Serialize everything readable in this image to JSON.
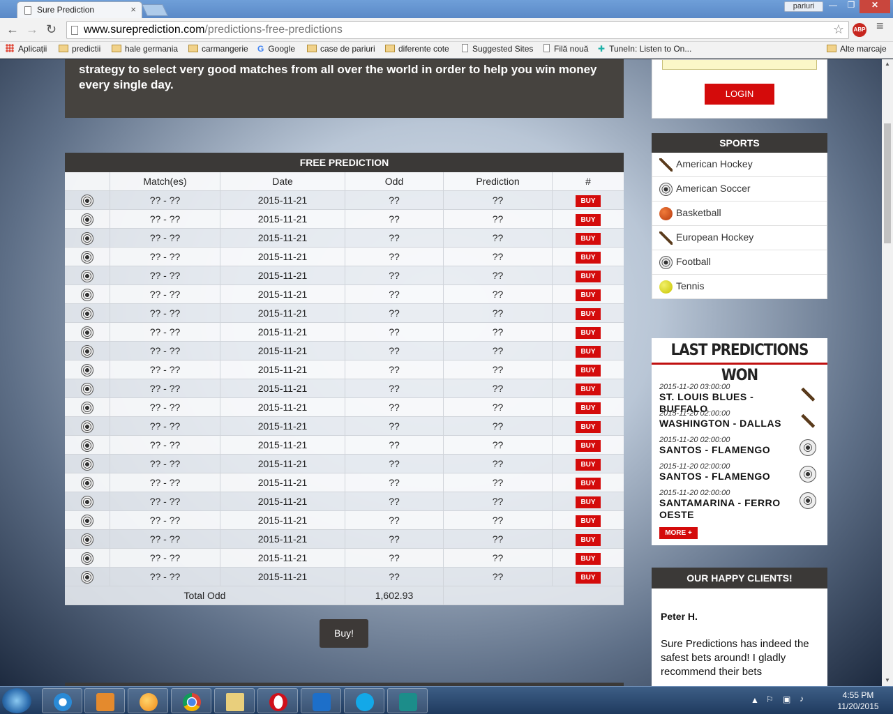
{
  "browser": {
    "tab_title": "Sure Prediction",
    "tab_close": "×",
    "profile": "pariuri",
    "url_host": "www.sureprediction.com",
    "url_path": "/predictions-free-predictions",
    "abp_label": "ABP",
    "controls": {
      "back": "←",
      "forward": "→",
      "reload": "↻",
      "minimize": "—",
      "maximize": "❐",
      "close": "✕",
      "star": "☆",
      "menu": "≡"
    }
  },
  "bookmarks": [
    {
      "label": "Aplicații",
      "icon": "apps-icon"
    },
    {
      "label": "predictii",
      "icon": "folder-icon"
    },
    {
      "label": "hale germania",
      "icon": "folder-icon"
    },
    {
      "label": "carmangerie",
      "icon": "folder-icon"
    },
    {
      "label": "Google",
      "icon": "google-icon"
    },
    {
      "label": "case de pariuri",
      "icon": "folder-icon"
    },
    {
      "label": "diferente cote",
      "icon": "folder-icon"
    },
    {
      "label": "Suggested Sites",
      "icon": "page-icon"
    },
    {
      "label": "Filă nouă",
      "icon": "page-icon"
    },
    {
      "label": "TuneIn: Listen to On...",
      "icon": "tunein-icon"
    },
    {
      "label": "Alte marcaje",
      "icon": "folder-icon"
    }
  ],
  "intro_text": "strategy to select very good matches from all over the world in order to help you win money every single day.",
  "free_prediction": {
    "title": "FREE PREDICTION",
    "headers": [
      "",
      "Match(es)",
      "Date",
      "Odd",
      "Prediction",
      "#"
    ],
    "rows": [
      {
        "match": "?? - ??",
        "date": "2015-11-21",
        "odd": "??",
        "prediction": "??",
        "action": "BUY"
      },
      {
        "match": "?? - ??",
        "date": "2015-11-21",
        "odd": "??",
        "prediction": "??",
        "action": "BUY"
      },
      {
        "match": "?? - ??",
        "date": "2015-11-21",
        "odd": "??",
        "prediction": "??",
        "action": "BUY"
      },
      {
        "match": "?? - ??",
        "date": "2015-11-21",
        "odd": "??",
        "prediction": "??",
        "action": "BUY"
      },
      {
        "match": "?? - ??",
        "date": "2015-11-21",
        "odd": "??",
        "prediction": "??",
        "action": "BUY"
      },
      {
        "match": "?? - ??",
        "date": "2015-11-21",
        "odd": "??",
        "prediction": "??",
        "action": "BUY"
      },
      {
        "match": "?? - ??",
        "date": "2015-11-21",
        "odd": "??",
        "prediction": "??",
        "action": "BUY"
      },
      {
        "match": "?? - ??",
        "date": "2015-11-21",
        "odd": "??",
        "prediction": "??",
        "action": "BUY"
      },
      {
        "match": "?? - ??",
        "date": "2015-11-21",
        "odd": "??",
        "prediction": "??",
        "action": "BUY"
      },
      {
        "match": "?? - ??",
        "date": "2015-11-21",
        "odd": "??",
        "prediction": "??",
        "action": "BUY"
      },
      {
        "match": "?? - ??",
        "date": "2015-11-21",
        "odd": "??",
        "prediction": "??",
        "action": "BUY"
      },
      {
        "match": "?? - ??",
        "date": "2015-11-21",
        "odd": "??",
        "prediction": "??",
        "action": "BUY"
      },
      {
        "match": "?? - ??",
        "date": "2015-11-21",
        "odd": "??",
        "prediction": "??",
        "action": "BUY"
      },
      {
        "match": "?? - ??",
        "date": "2015-11-21",
        "odd": "??",
        "prediction": "??",
        "action": "BUY"
      },
      {
        "match": "?? - ??",
        "date": "2015-11-21",
        "odd": "??",
        "prediction": "??",
        "action": "BUY"
      },
      {
        "match": "?? - ??",
        "date": "2015-11-21",
        "odd": "??",
        "prediction": "??",
        "action": "BUY"
      },
      {
        "match": "?? - ??",
        "date": "2015-11-21",
        "odd": "??",
        "prediction": "??",
        "action": "BUY"
      },
      {
        "match": "?? - ??",
        "date": "2015-11-21",
        "odd": "??",
        "prediction": "??",
        "action": "BUY"
      },
      {
        "match": "?? - ??",
        "date": "2015-11-21",
        "odd": "??",
        "prediction": "??",
        "action": "BUY"
      },
      {
        "match": "?? - ??",
        "date": "2015-11-21",
        "odd": "??",
        "prediction": "??",
        "action": "BUY"
      },
      {
        "match": "?? - ??",
        "date": "2015-11-21",
        "odd": "??",
        "prediction": "??",
        "action": "BUY"
      }
    ],
    "total_label": "Total Odd",
    "total_value": "1,602.93",
    "buy_button": "Buy!"
  },
  "login": {
    "button": "LOGIN"
  },
  "sports": {
    "title": "SPORTS",
    "items": [
      {
        "label": "American Hockey",
        "icon": "hockey-stick-icon"
      },
      {
        "label": "American Soccer",
        "icon": "soccer-ball-icon"
      },
      {
        "label": "Basketball",
        "icon": "basketball-icon"
      },
      {
        "label": "European Hockey",
        "icon": "hockey-stick-icon"
      },
      {
        "label": "Football",
        "icon": "soccer-ball-icon"
      },
      {
        "label": "Tennis",
        "icon": "tennis-ball-icon"
      }
    ]
  },
  "last_won": {
    "title": "LAST PREDICTIONS WON",
    "items": [
      {
        "datetime": "2015-11-20 03:00:00",
        "match": "ST. LOUIS BLUES - BUFFALO",
        "icon": "hockey-stick-icon"
      },
      {
        "datetime": "2015-11-20 02:00:00",
        "match": "WASHINGTON - DALLAS",
        "icon": "hockey-stick-icon"
      },
      {
        "datetime": "2015-11-20 02:00:00",
        "match": "SANTOS - FLAMENGO",
        "icon": "soccer-ball-icon"
      },
      {
        "datetime": "2015-11-20 02:00:00",
        "match": "SANTOS - FLAMENGO",
        "icon": "soccer-ball-icon"
      },
      {
        "datetime": "2015-11-20 02:00:00",
        "match": "SANTAMARINA - FERRO OESTE",
        "icon": "soccer-ball-icon"
      }
    ],
    "more_button": "MORE +"
  },
  "clients": {
    "title": "OUR HAPPY CLIENTS!",
    "name": "Peter H.",
    "quote": "Sure Predictions has indeed the safest bets around! I gladly recommend their bets"
  },
  "taskbar": {
    "apps": [
      "internet-explorer-icon",
      "media-player-icon",
      "messenger-icon",
      "chrome-icon",
      "file-explorer-icon",
      "opera-icon",
      "teamviewer-icon",
      "skype-icon",
      "eset-icon"
    ],
    "time": "4:55 PM",
    "date": "11/20/2015"
  },
  "colors": {
    "accent_red": "#d40b0b",
    "panel_dark": "#3b3937"
  }
}
